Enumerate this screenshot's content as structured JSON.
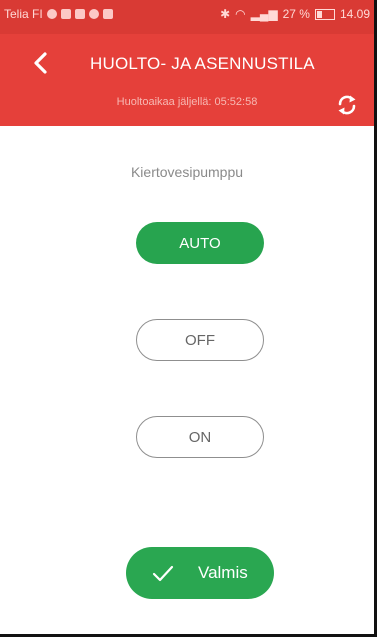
{
  "statusbar": {
    "carrier": "Telia FI",
    "battery_percent": "27 %",
    "time": "14.09"
  },
  "appbar": {
    "title": "HUOLTO- JA ASENNUSTILA",
    "subtitle": "Huoltoaikaa jäljellä: 05:52:58",
    "back_icon": "chevron-left-icon",
    "refresh_icon": "refresh-icon"
  },
  "pump": {
    "label": "Kiertovesipumppu",
    "options": [
      {
        "label": "AUTO",
        "selected": true
      },
      {
        "label": "OFF",
        "selected": false
      },
      {
        "label": "ON",
        "selected": false
      }
    ]
  },
  "done_button": {
    "label": "Valmis",
    "icon": "check-icon"
  },
  "colors": {
    "header": "#e5403a",
    "statusbar": "#d93a34",
    "accent_green": "#27a44f"
  }
}
